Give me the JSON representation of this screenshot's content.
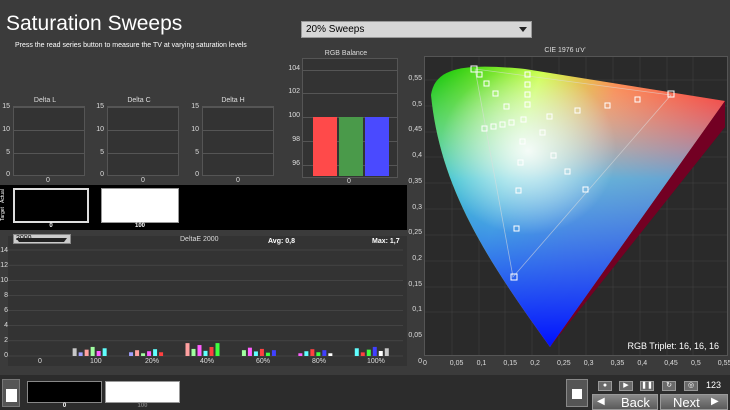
{
  "header": {
    "title": "Saturation Sweeps",
    "subtitle": "Press the read series button to measure the TV at varying saturation levels",
    "sweep_selected": "20% Sweeps"
  },
  "delta_l": {
    "title": "Delta L",
    "ticks": [
      "15",
      "10",
      "5",
      "0"
    ],
    "xlabel": "0"
  },
  "delta_c": {
    "title": "Delta C",
    "ticks": [
      "15",
      "10",
      "5",
      "0"
    ],
    "xlabel": "0"
  },
  "delta_h": {
    "title": "Delta H",
    "ticks": [
      "15",
      "10",
      "5",
      "0"
    ],
    "xlabel": "0"
  },
  "rgb_balance": {
    "title": "RGB Balance",
    "ticks": [
      "104",
      "102",
      "100",
      "98",
      "96"
    ],
    "xlabel": "0",
    "values": {
      "r": 100,
      "g": 100,
      "b": 100
    },
    "colors": {
      "r": "#ff4a4a",
      "g": "#4a9a4a",
      "b": "#4a4aff"
    }
  },
  "strip": {
    "side_labels": [
      "Actual",
      "Target"
    ],
    "swatches": [
      {
        "label": "0",
        "color": "#000000"
      },
      {
        "label": "100",
        "color": "#ffffff"
      }
    ]
  },
  "deltae": {
    "dropdown": "2000",
    "title": "DeltaE 2000",
    "avg": "Avg: 0,8",
    "max": "Max: 1,7",
    "yticks": [
      "14",
      "12",
      "10",
      "8",
      "6",
      "4",
      "2",
      "0"
    ],
    "xticks": [
      "0",
      "100",
      "20%",
      "40%",
      "60%",
      "80%",
      "100%"
    ]
  },
  "cie": {
    "title": "CIE 1976 u'v'",
    "xticks": [
      "0",
      "0,05",
      "0,1",
      "0,15",
      "0,2",
      "0,25",
      "0,3",
      "0,35",
      "0,4",
      "0,45",
      "0,5",
      "0,55"
    ],
    "yticks": [
      "0,55",
      "0,5",
      "0,45",
      "0,4",
      "0,35",
      "0,3",
      "0,25",
      "0,2",
      "0,15",
      "0,1",
      "0,05",
      "0"
    ],
    "triplet": "RGB Triplet: 16, 16, 16"
  },
  "bottom": {
    "swatches": [
      {
        "label": "0",
        "color": "#000000"
      },
      {
        "label": "100",
        "color": "#ffffff"
      }
    ],
    "back": "Back",
    "next": "Next",
    "counter": "123"
  },
  "chart_data": {
    "type": "bar",
    "title": "DeltaE 2000",
    "categories": [
      "0",
      "100",
      "20%",
      "40%",
      "60%",
      "80%",
      "100%"
    ],
    "ylim": [
      0,
      14
    ],
    "series": [
      {
        "values": [
          0,
          1.2,
          0.9,
          1.7,
          1.1,
          0.9,
          1.2
        ]
      }
    ]
  }
}
